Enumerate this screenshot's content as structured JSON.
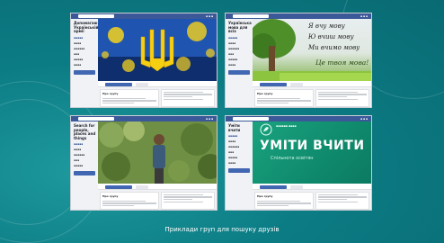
{
  "caption": "Приклади груп для пошуку друзів",
  "colors": {
    "background_teal": "#0c7c84",
    "facebook_blue": "#3b5998",
    "join_button": "#4267b2",
    "caption_text": "#ffffff"
  },
  "panels": {
    "p1": {
      "group_name": "Допомагаю Українській армії",
      "cover_description": "blue background with yellow trident, yellow splashes",
      "post_title": "Про групу"
    },
    "p2": {
      "group_name": "Українська мова для всіх",
      "cover_lines": [
        "Я вчу мову",
        "Ю вчиш мову",
        "Ми вчимо мову",
        "Це твоя мова!"
      ],
      "post_title": "Про групу"
    },
    "p3": {
      "group_name": "Search for people, places and things",
      "cover_description": "man standing among green foliage",
      "post_title": "Про групу"
    },
    "p4": {
      "group_name": "Уміти вчити",
      "cover_title": "УМІТИ ВЧИТИ",
      "cover_subtitle": "Спільнота освітян",
      "post_title": "Про групу"
    }
  }
}
